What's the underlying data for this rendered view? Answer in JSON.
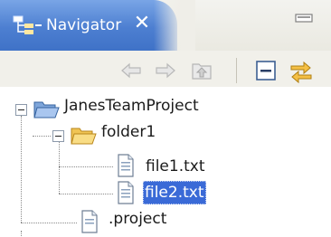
{
  "view": {
    "title": "Navigator",
    "close_glyph": "✕",
    "view_icon": "navigator-view-icon",
    "minimize_icon": "minimize-icon"
  },
  "toolbar": {
    "buttons": [
      {
        "name": "back-button",
        "icon": "back-arrow-icon"
      },
      {
        "name": "forward-button",
        "icon": "forward-arrow-icon"
      },
      {
        "name": "up-button",
        "icon": "go-up-icon"
      },
      {
        "name": "collapse-all-button",
        "icon": "collapse-all-icon"
      },
      {
        "name": "link-with-editor-button",
        "icon": "link-with-editor-icon"
      }
    ]
  },
  "tree": {
    "project": {
      "label": "JanesTeamProject",
      "expanded": true,
      "children": {
        "folder1": {
          "label": "folder1",
          "expanded": true,
          "files": [
            {
              "label": "file1.txt",
              "selected": false
            },
            {
              "label": "file2.txt",
              "selected": true
            }
          ]
        },
        "project_file": {
          "label": ".project"
        }
      }
    }
  },
  "colors": {
    "tab_active": "#4d7fd1",
    "selection": "#3a6ad7",
    "folder": "#f0c454",
    "project_folder": "#7fa6da"
  }
}
